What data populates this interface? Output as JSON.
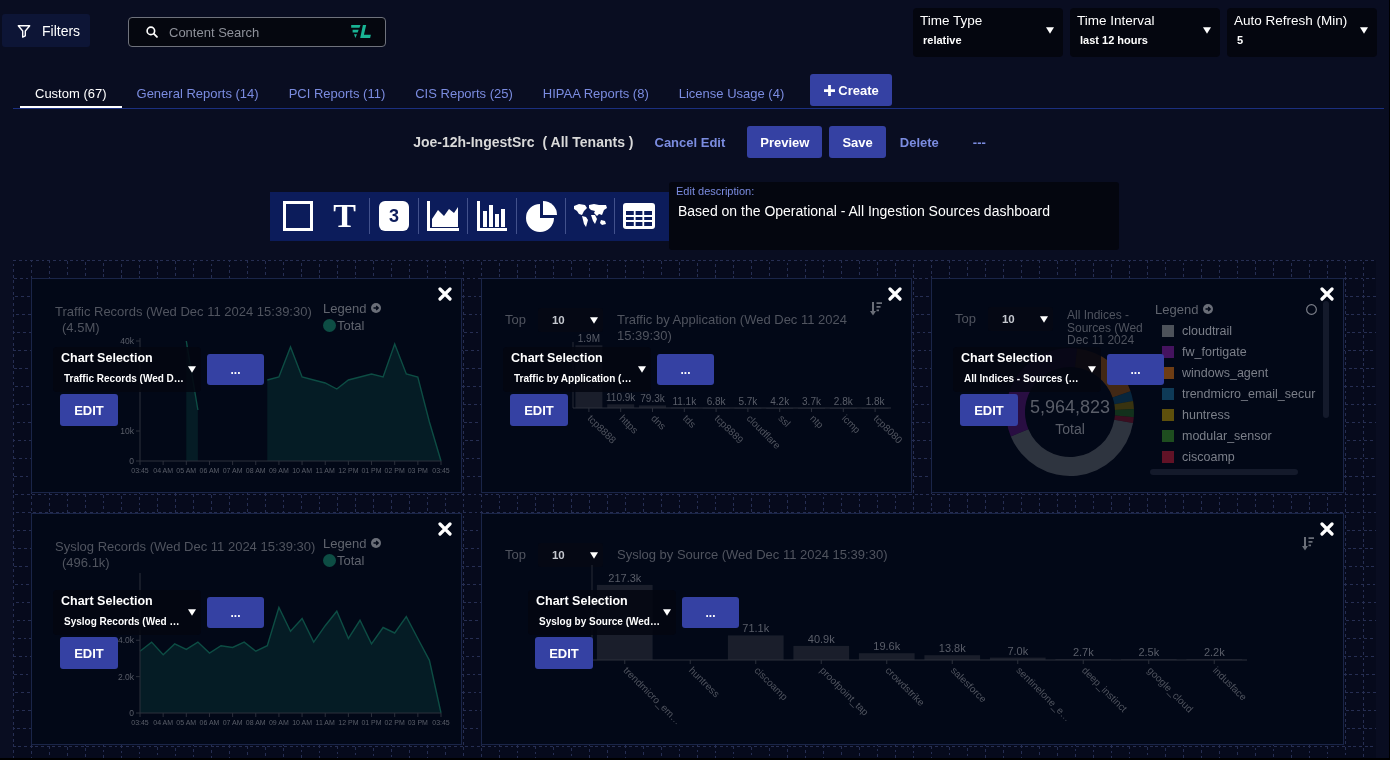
{
  "filters_button": {
    "label": "Filters"
  },
  "search": {
    "placeholder": "Content Search"
  },
  "time_controls": [
    {
      "label": "Time Type",
      "value": "relative"
    },
    {
      "label": "Time Interval",
      "value": "last 12 hours"
    },
    {
      "label": "Auto Refresh (Min)",
      "value": "5"
    }
  ],
  "tabs": [
    {
      "label": "Custom (67)",
      "selected": true
    },
    {
      "label": "General Reports (14)",
      "selected": false
    },
    {
      "label": "PCI Reports (11)",
      "selected": false
    },
    {
      "label": "CIS Reports (25)",
      "selected": false
    },
    {
      "label": "HIPAA Reports (8)",
      "selected": false
    },
    {
      "label": "License Usage (4)",
      "selected": false
    }
  ],
  "create_button": {
    "label": "Create"
  },
  "report": {
    "name": "Joe-12h-IngestSrc",
    "scope": "( All Tenants )",
    "actions": [
      {
        "kind": "link",
        "label": "Cancel Edit"
      },
      {
        "kind": "button",
        "label": "Preview"
      },
      {
        "kind": "button",
        "label": "Save"
      },
      {
        "kind": "link",
        "label": "Delete"
      },
      {
        "kind": "menu",
        "label": "---"
      }
    ]
  },
  "widget_toolbar": [
    {
      "kind": "box"
    },
    {
      "kind": "text",
      "glyph": "T"
    },
    {
      "kind": "number",
      "glyph": "3"
    },
    {
      "kind": "area"
    },
    {
      "kind": "bar"
    },
    {
      "kind": "pie"
    },
    {
      "kind": "map"
    },
    {
      "kind": "table"
    }
  ],
  "description": {
    "label": "Edit description:",
    "value": "Based on the Operational - All Ingestion Sources dashboard"
  },
  "widgets": [
    {
      "kind": "line",
      "title": "Traffic Records (Wed Dec 11 2024 15:39:30)",
      "total": "(4.5M)",
      "legend_label": "Legend",
      "chart_selection": {
        "label": "Chart Selection",
        "value": "Traffic Records (Wed D…"
      },
      "more_label": "...",
      "edit_label": "EDIT",
      "chart_data": {
        "type": "area",
        "categories": [
          "03:45",
          null,
          "04 AM",
          null,
          "05 AM",
          null,
          "06 AM",
          null,
          "07 AM",
          null,
          "08 AM",
          null,
          "09 AM",
          null,
          "10 AM",
          null,
          "11 AM",
          null,
          "12 PM",
          null,
          "01 PM",
          null,
          "02 PM",
          null,
          "03 PM",
          null,
          "03:45"
        ],
        "series": [
          {
            "name": "Total",
            "color": "#0d4d44",
            "values": [
              null,
              null,
              null,
              null,
              40000,
              17000,
              null,
              null,
              null,
              null,
              null,
              27000,
              28000,
              38000,
              28000,
              27000,
              26000,
              24000,
              27000,
              28000,
              29000,
              28000,
              39000,
              29000,
              28000,
              13000,
              0
            ]
          }
        ],
        "ylim": [
          0,
          41000
        ],
        "yticks": [
          {
            "value": 40000,
            "label": "40k"
          },
          {
            "value": 10000,
            "label": "10k"
          },
          {
            "value": 0,
            "label": "0"
          }
        ]
      }
    },
    {
      "kind": "bar",
      "top": {
        "label": "Top",
        "value": "10"
      },
      "title": "Traffic by Application (Wed Dec 11 2024 15:39:30)",
      "chart_selection": {
        "label": "Chart Selection",
        "value": "Traffic by Application (…"
      },
      "more_label": "...",
      "edit_label": "EDIT",
      "chart_data": {
        "type": "bar",
        "categories": [
          "tcp8888",
          "https",
          "dns",
          "tds",
          "tcp8889",
          "cloudflare",
          "ssl",
          "ntp",
          "icmp",
          "tcp8080"
        ],
        "values": [
          1900000,
          110900,
          79300,
          11100,
          6800,
          5700,
          4200,
          3700,
          2800,
          1800
        ],
        "value_labels": [
          "1.9M",
          "110.9k",
          "79.3k",
          "11.1k",
          "6.8k",
          "5.7k",
          "4.2k",
          "3.7k",
          "2.8k",
          "1.8k"
        ],
        "ylim": [
          0,
          2000000
        ]
      }
    },
    {
      "kind": "donut",
      "top": {
        "label": "Top",
        "value": "10"
      },
      "title": "All Indices - Sources (Wed Dec 11 2024",
      "center_value": "5,964,823",
      "center_label": "Total",
      "legend_label": "Legend",
      "legend_items": [
        {
          "label": "cloudtrail",
          "color": "#4d525a"
        },
        {
          "label": "fw_fortigate",
          "color": "#45135f"
        },
        {
          "label": "windows_agent",
          "color": "#6e3d14"
        },
        {
          "label": "trendmicro_email_secur",
          "color": "#0e3a57"
        },
        {
          "label": "huntress",
          "color": "#5e500c"
        },
        {
          "label": "modular_sensor",
          "color": "#1e4d1f"
        },
        {
          "label": "ciscoamp",
          "color": "#611226"
        }
      ],
      "chart_selection": {
        "label": "Chart Selection",
        "value": "All Indices - Sources (…"
      },
      "more_label": "...",
      "edit_label": "EDIT"
    },
    {
      "kind": "line",
      "title": "Syslog Records (Wed Dec 11 2024 15:39:30)",
      "total": "(496.1k)",
      "legend_label": "Legend",
      "chart_selection": {
        "label": "Chart Selection",
        "value": "Syslog Records (Wed …"
      },
      "more_label": "...",
      "edit_label": "EDIT",
      "chart_data": {
        "type": "area",
        "categories": [
          "03:45",
          null,
          "04 AM",
          null,
          "05 AM",
          null,
          "06 AM",
          null,
          "07 AM",
          null,
          "08 AM",
          null,
          "09 AM",
          null,
          "10 AM",
          null,
          "11 AM",
          null,
          "12 PM",
          null,
          "01 PM",
          null,
          "02 PM",
          null,
          "03 PM",
          null,
          "03:45"
        ],
        "series": [
          {
            "name": "Total",
            "color": "#0d4d44",
            "values": [
              3400,
              3900,
              3200,
              3800,
              3500,
              3900,
              3300,
              3700,
              3600,
              3900,
              3400,
              3700,
              5800,
              4500,
              5200,
              3900,
              4800,
              5600,
              4100,
              5100,
              3800,
              4700,
              4400,
              5300,
              4100,
              2900,
              0
            ]
          }
        ],
        "ylim": [
          0,
          7700
        ],
        "yticks": [
          {
            "value": 4000,
            "label": "4.0k"
          },
          {
            "value": 2000,
            "label": "2.0k"
          },
          {
            "value": 0,
            "label": "0"
          }
        ]
      }
    },
    {
      "kind": "bar",
      "top": {
        "label": "Top",
        "value": "10"
      },
      "title": "Syslog by Source (Wed Dec 11 2024 15:39:30)",
      "chart_selection": {
        "label": "Chart Selection",
        "value": "Syslog by Source (Wed…"
      },
      "more_label": "...",
      "edit_label": "EDIT",
      "chart_data": {
        "type": "bar",
        "categories": [
          "trendmicro_em…",
          "huntress",
          "ciscoamp",
          "proofpoint_tap",
          "crowdstrike",
          "salesforce",
          "sentinelone_e…",
          "deep_instinct",
          "google_cloud",
          "indusface"
        ],
        "values": [
          217300,
          null,
          71100,
          40900,
          19600,
          13800,
          7000,
          2700,
          2500,
          2200
        ],
        "value_labels": [
          "217.3k",
          null,
          "71.1k",
          "40.9k",
          "19.6k",
          "13.8k",
          "7.0k",
          "2.7k",
          "2.5k",
          "2.2k"
        ],
        "ylim": [
          0,
          275000
        ]
      }
    }
  ]
}
